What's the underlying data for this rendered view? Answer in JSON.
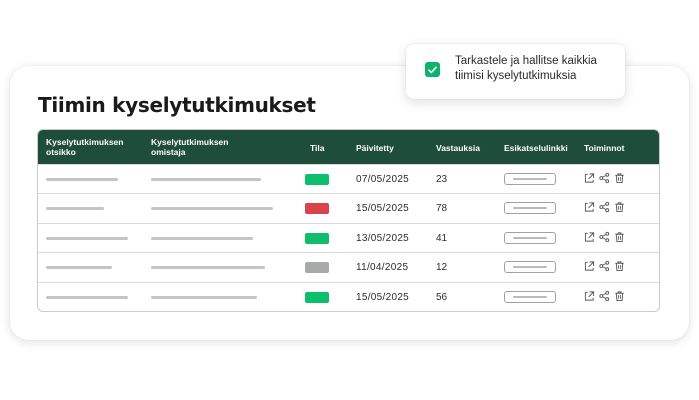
{
  "page": {
    "title": "Tiimin kyselytutkimukset"
  },
  "toast": {
    "message": "Tarkastele ja hallitse kaikkia tiimisi kyselytutkimuksia",
    "check_color": "#0db36a",
    "icon": "check-icon"
  },
  "table": {
    "headers": {
      "survey_title_line1": "Kyselytutkimuksen",
      "survey_title_line2": "otsikko",
      "owner_line1": "Kyselytutkimuksen",
      "owner_line2": "omistaja",
      "status": "Tila",
      "updated": "Päivitetty",
      "responses": "Vastauksia",
      "preview": "Esikatselulinkki",
      "actions": "Toiminnot"
    },
    "header_color": "#1e4d3b",
    "status_colors": {
      "active": "#0dbf6c",
      "closed": "#d9434e",
      "draft": "#a8aaa9"
    },
    "action_icons": [
      "export-icon",
      "share-icon",
      "trash-icon"
    ],
    "rows": [
      {
        "status": "active",
        "updated": "07/05/2025",
        "responses": "23"
      },
      {
        "status": "closed",
        "updated": "15/05/2025",
        "responses": "78"
      },
      {
        "status": "active",
        "updated": "13/05/2025",
        "responses": "41"
      },
      {
        "status": "draft",
        "updated": "11/04/2025",
        "responses": "12"
      },
      {
        "status": "active",
        "updated": "15/05/2025",
        "responses": "56"
      }
    ]
  }
}
